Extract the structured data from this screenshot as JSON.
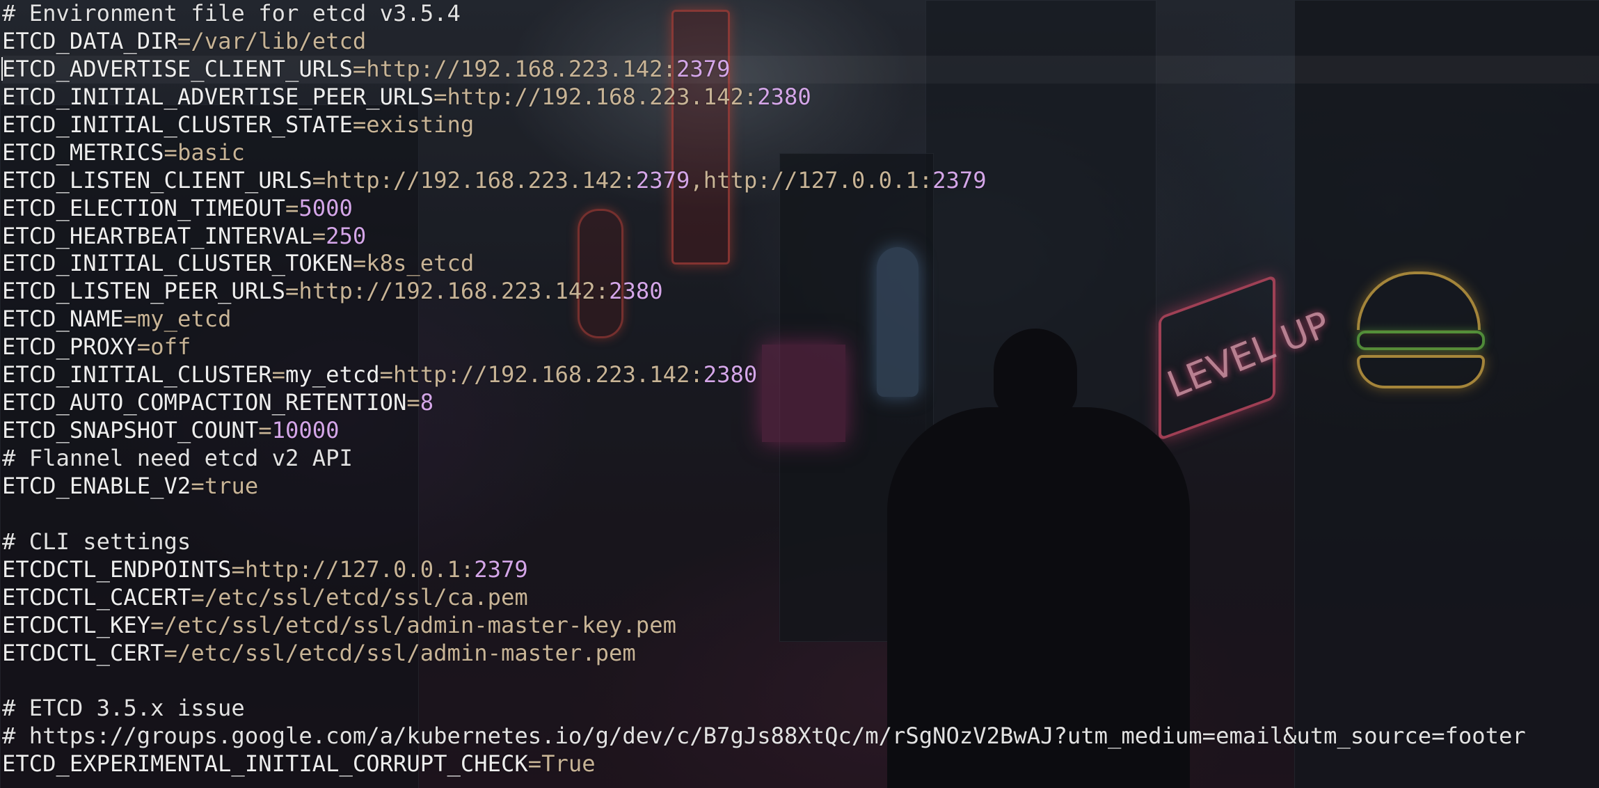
{
  "window": {
    "type": "terminal",
    "wallpaper": "neon-city-night"
  },
  "colors": {
    "key": "#eeeeee",
    "value": "#c8b496",
    "number": "#d4a6e8",
    "comment": "#e2e2e2"
  },
  "lines": [
    {
      "comment": "# Environment file for etcd v3.5.4"
    },
    {
      "key": "ETCD_DATA_DIR",
      "value": "/var/lib/etcd"
    },
    {
      "key": "ETCD_ADVERTISE_CLIENT_URLS",
      "value": "http://192.168.223.142:",
      "num": "2379",
      "cursor": true
    },
    {
      "key": "ETCD_INITIAL_ADVERTISE_PEER_URLS",
      "value": "http://192.168.223.142:",
      "num": "2380"
    },
    {
      "key": "ETCD_INITIAL_CLUSTER_STATE",
      "value": "existing"
    },
    {
      "key": "ETCD_METRICS",
      "value": "basic"
    },
    {
      "key": "ETCD_LISTEN_CLIENT_URLS",
      "value": "http://192.168.223.142:",
      "num": "2379",
      "value2": ",http://127.0.0.1:",
      "num2": "2379"
    },
    {
      "key": "ETCD_ELECTION_TIMEOUT",
      "num": "5000"
    },
    {
      "key": "ETCD_HEARTBEAT_INTERVAL",
      "num": "250"
    },
    {
      "key": "ETCD_INITIAL_CLUSTER_TOKEN",
      "value": "k8s_etcd"
    },
    {
      "key": "ETCD_LISTEN_PEER_URLS",
      "value": "http://192.168.223.142:",
      "num": "2380"
    },
    {
      "key": "ETCD_NAME",
      "value": "my_etcd"
    },
    {
      "key": "ETCD_PROXY",
      "value": "off"
    },
    {
      "key": "ETCD_INITIAL_CLUSTER",
      "key2": "my_etcd",
      "value": "http://192.168.223.142:",
      "num": "2380"
    },
    {
      "key": "ETCD_AUTO_COMPACTION_RETENTION",
      "num": "8"
    },
    {
      "key": "ETCD_SNAPSHOT_COUNT",
      "num": "10000"
    },
    {
      "comment": "# Flannel need etcd v2 API"
    },
    {
      "key": "ETCD_ENABLE_V2",
      "value": "true"
    },
    {
      "blank": true
    },
    {
      "comment": "# CLI settings"
    },
    {
      "key": "ETCDCTL_ENDPOINTS",
      "value": "http://127.0.0.1:",
      "num": "2379"
    },
    {
      "key": "ETCDCTL_CACERT",
      "value": "/etc/ssl/etcd/ssl/ca.pem"
    },
    {
      "key": "ETCDCTL_KEY",
      "value": "/etc/ssl/etcd/ssl/admin-master-key.pem"
    },
    {
      "key": "ETCDCTL_CERT",
      "value": "/etc/ssl/etcd/ssl/admin-master.pem"
    },
    {
      "blank": true
    },
    {
      "comment": "# ETCD 3.5.x issue"
    },
    {
      "comment": "# https://groups.google.com/a/kubernetes.io/g/dev/c/B7gJs88XtQc/m/rSgNOzV2BwAJ?utm_medium=email&utm_source=footer"
    },
    {
      "key": "ETCD_EXPERIMENTAL_INITIAL_CORRUPT_CHECK",
      "value": "True"
    }
  ],
  "background_signs": {
    "neon": "LEVEL UP"
  }
}
